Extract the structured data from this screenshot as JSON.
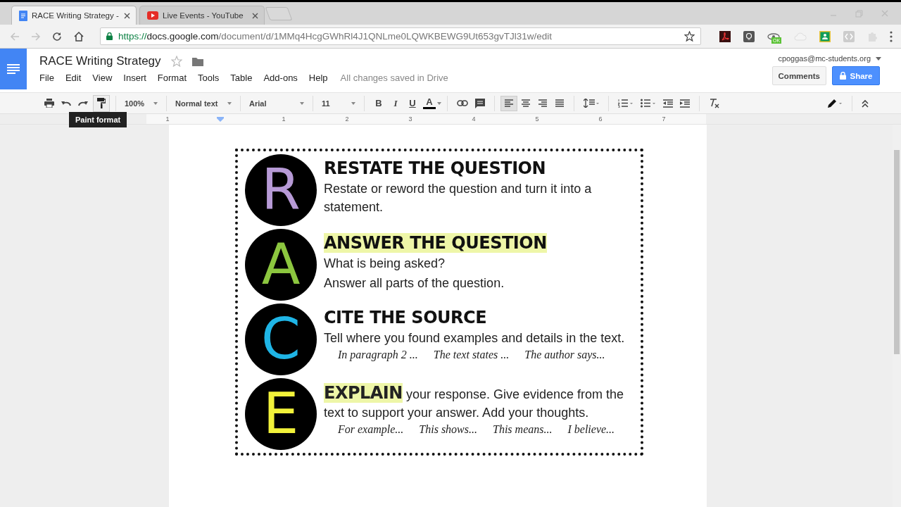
{
  "browser": {
    "tabs": [
      {
        "title": "RACE Writing Strategy -",
        "kind": "docs",
        "selected": true
      },
      {
        "title": "Live Events - YouTube",
        "kind": "video",
        "selected": false
      }
    ],
    "url": {
      "scheme": "https://",
      "host": "docs.google.com",
      "path": "/document/d/1MMq4HcgGWhRl4J1QNLme0LQWKBEWG9Ut653gvTJl31w/edit"
    },
    "extension_badge": "OK"
  },
  "document": {
    "title": "RACE Writing Strategy",
    "status": "All changes saved in Drive",
    "account": "cpoggas@mc-students.org"
  },
  "menu": [
    "File",
    "Edit",
    "View",
    "Insert",
    "Format",
    "Tools",
    "Table",
    "Add-ons",
    "Help"
  ],
  "buttons": {
    "comments": "Comments",
    "share": "Share"
  },
  "toolbar": {
    "zoom": "100%",
    "style": "Normal text",
    "font": "Arial",
    "size": "11",
    "format_buttons": [
      "B",
      "I",
      "U",
      "A"
    ],
    "tooltip": "Paint format",
    "alignments": [
      {
        "kind": "left",
        "selected": true
      },
      {
        "kind": "center",
        "selected": false
      },
      {
        "kind": "right",
        "selected": false
      },
      {
        "kind": "justify",
        "selected": false
      }
    ]
  },
  "ruler": [
    "1",
    "1",
    "2",
    "3",
    "4",
    "5",
    "6",
    "7"
  ],
  "poster": [
    {
      "letter": "R",
      "color": "#b79ad6",
      "kind": "block",
      "heading": "RESTATE THE QUESTION",
      "highlighted": false,
      "lines": [
        "Restate or reword the question and turn it into a statement."
      ]
    },
    {
      "letter": "A",
      "color": "#8cc63f",
      "kind": "block",
      "heading": "ANSWER THE QUESTION",
      "highlighted": true,
      "lines": [
        "What is being asked?",
        "Answer all parts of the question."
      ]
    },
    {
      "letter": "C",
      "color": "#1fb5e6",
      "kind": "block",
      "heading": "CITE THE SOURCE",
      "highlighted": false,
      "lines": [
        "Tell where you found examples and details in the text."
      ],
      "examples": [
        "In paragraph 2 ...",
        "The text states ...",
        "The author says..."
      ]
    },
    {
      "letter": "E",
      "color": "#f2f23a",
      "kind": "inline",
      "highlighted": true,
      "text": "**EXPLAIN** your response. Give evidence from the text to support your answer. Add your thoughts.",
      "examples": [
        "For example...",
        "This shows...",
        "This means...",
        "I believe..."
      ]
    }
  ]
}
